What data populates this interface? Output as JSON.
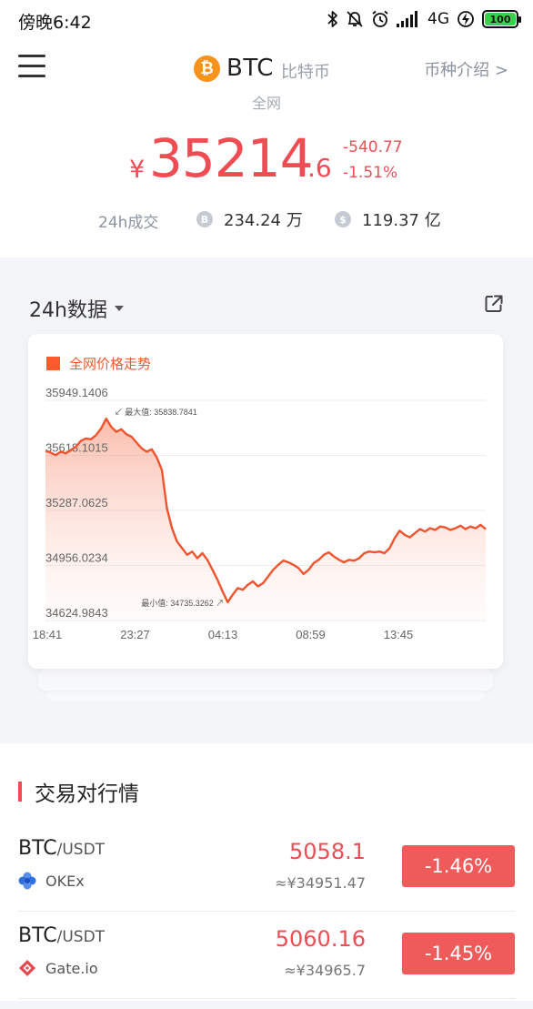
{
  "status_bar": {
    "time": "傍晚6:42",
    "network": "4G",
    "battery": "100",
    "icons": [
      "bluetooth-icon",
      "dnd-off-icon",
      "alarm-icon",
      "signal-icon",
      "charging-icon",
      "battery-icon"
    ]
  },
  "header": {
    "coin_symbol": "BTC",
    "coin_name_cn": "比特币",
    "market_scope": "全网",
    "intro_link": "币种介绍 >",
    "coin_icon": "bitcoin-icon"
  },
  "price": {
    "currency": "¥",
    "integer": "35214",
    "decimal": ".6",
    "change_abs": "-540.77",
    "change_pct": "-1.51%"
  },
  "volume": {
    "label": "24h成交",
    "btc_volume": "234.24 万",
    "cny_volume": "119.37 亿"
  },
  "chart_section": {
    "title": "24h数据",
    "legend": "全网价格走势",
    "max_label": "最大值: 35838.7841",
    "min_label": "最小值: 34735.3262"
  },
  "chart_data": {
    "type": "area",
    "ylim": [
      34624.9843,
      35949.1406
    ],
    "y_ticks": [
      "35949.1406",
      "35618.1015",
      "35287.0625",
      "34956.0234",
      "34624.9843"
    ],
    "x_ticks": [
      "18:41",
      "23:27",
      "04:13",
      "08:59",
      "13:45"
    ],
    "series": [
      {
        "name": "全网价格走势",
        "values": [
          35645,
          35635,
          35620,
          35640,
          35630,
          35650,
          35670,
          35705,
          35720,
          35715,
          35740,
          35780,
          35839,
          35790,
          35760,
          35775,
          35745,
          35730,
          35695,
          35660,
          35640,
          35655,
          35605,
          35530,
          35300,
          35180,
          35100,
          35060,
          35020,
          35040,
          35000,
          35030,
          34990,
          34930,
          34870,
          34800,
          34735,
          34780,
          34820,
          34810,
          34840,
          34860,
          34830,
          34850,
          34890,
          34930,
          34960,
          34985,
          34975,
          34960,
          34940,
          34905,
          34930,
          34970,
          34990,
          35020,
          35035,
          35010,
          34990,
          34975,
          34990,
          34985,
          35000,
          35030,
          35040,
          35035,
          35040,
          35030,
          35060,
          35120,
          35165,
          35140,
          35125,
          35150,
          35175,
          35160,
          35180,
          35170,
          35190,
          35185,
          35170,
          35180,
          35195,
          35175,
          35190,
          35180,
          35200,
          35175
        ]
      }
    ],
    "color": "#f0532d",
    "grid": true,
    "legend_position": "top-left"
  },
  "pairs_section": {
    "title": "交易对行情",
    "pairs": [
      {
        "base": "BTC",
        "quote": "/USDT",
        "exchange": "OKEx",
        "price": "5058.1",
        "cny": "≈¥34951.47",
        "change": "-1.46%",
        "icon": "okex-icon"
      },
      {
        "base": "BTC",
        "quote": "/USDT",
        "exchange": "Gate.io",
        "price": "5060.16",
        "cny": "≈¥34965.7",
        "change": "-1.45%",
        "icon": "gateio-icon"
      }
    ]
  },
  "colors": {
    "accent": "#ef4c53",
    "chart_line": "#f0532d",
    "change_badge": "#ef5b5b"
  }
}
